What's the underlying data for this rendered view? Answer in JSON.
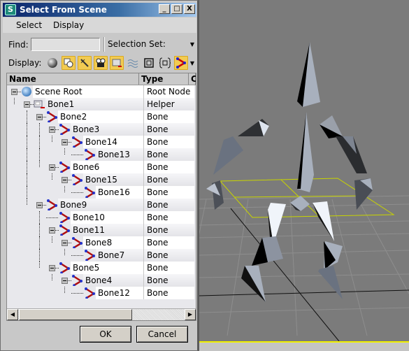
{
  "window": {
    "title": "Select From Scene",
    "app_icon": "3dsmax-icon",
    "controls": [
      "minimize",
      "maximize",
      "close"
    ],
    "control_glyphs": [
      "_",
      "□",
      "X"
    ]
  },
  "menubar": {
    "items": [
      {
        "label": "Select"
      },
      {
        "label": "Display"
      }
    ]
  },
  "findbar": {
    "find_label": "Find:",
    "find_value": "",
    "selection_set_label": "Selection Set:",
    "selection_set_value": ""
  },
  "displaybar": {
    "label": "Display:",
    "filters": [
      {
        "name": "geometry",
        "active": false
      },
      {
        "name": "shapes",
        "active": true
      },
      {
        "name": "lights",
        "active": true
      },
      {
        "name": "cameras",
        "active": true
      },
      {
        "name": "helpers",
        "active": true
      },
      {
        "name": "space-warps",
        "active": false
      },
      {
        "name": "groups",
        "active": false
      },
      {
        "name": "xrefs",
        "active": false
      },
      {
        "name": "bones",
        "active": true
      }
    ]
  },
  "table": {
    "columns": [
      {
        "label": "Name"
      },
      {
        "label": "Type"
      },
      {
        "label": "C"
      }
    ],
    "rows": [
      {
        "name": "Scene Root",
        "type": "Root Node",
        "depth": 0,
        "icon": "scene-root",
        "expandable": true
      },
      {
        "name": "Bone1",
        "type": "Helper",
        "depth": 1,
        "icon": "helper",
        "expandable": true
      },
      {
        "name": "Bone2",
        "type": "Bone",
        "depth": 2,
        "icon": "bone",
        "expandable": true
      },
      {
        "name": "Bone3",
        "type": "Bone",
        "depth": 3,
        "icon": "bone",
        "expandable": true
      },
      {
        "name": "Bone14",
        "type": "Bone",
        "depth": 4,
        "icon": "bone",
        "expandable": true
      },
      {
        "name": "Bone13",
        "type": "Bone",
        "depth": 5,
        "icon": "bone",
        "expandable": false
      },
      {
        "name": "Bone6",
        "type": "Bone",
        "depth": 3,
        "icon": "bone",
        "expandable": true
      },
      {
        "name": "Bone15",
        "type": "Bone",
        "depth": 4,
        "icon": "bone",
        "expandable": true
      },
      {
        "name": "Bone16",
        "type": "Bone",
        "depth": 5,
        "icon": "bone",
        "expandable": false
      },
      {
        "name": "Bone9",
        "type": "Bone",
        "depth": 2,
        "icon": "bone",
        "expandable": true
      },
      {
        "name": "Bone10",
        "type": "Bone",
        "depth": 3,
        "icon": "bone",
        "expandable": false
      },
      {
        "name": "Bone11",
        "type": "Bone",
        "depth": 3,
        "icon": "bone",
        "expandable": true
      },
      {
        "name": "Bone8",
        "type": "Bone",
        "depth": 4,
        "icon": "bone",
        "expandable": true
      },
      {
        "name": "Bone7",
        "type": "Bone",
        "depth": 5,
        "icon": "bone",
        "expandable": false
      },
      {
        "name": "Bone5",
        "type": "Bone",
        "depth": 3,
        "icon": "bone",
        "expandable": true
      },
      {
        "name": "Bone4",
        "type": "Bone",
        "depth": 4,
        "icon": "bone",
        "expandable": true
      },
      {
        "name": "Bone12",
        "type": "Bone",
        "depth": 5,
        "icon": "bone",
        "expandable": false
      }
    ]
  },
  "buttons": {
    "ok": "OK",
    "cancel": "Cancel"
  },
  "colors": {
    "toggle_active": "#f2cb52",
    "title_start": "#0a246a",
    "title_end": "#a6caf0",
    "viewport_bg": "#7b7b7b",
    "grid_selection": "#c8d400"
  }
}
